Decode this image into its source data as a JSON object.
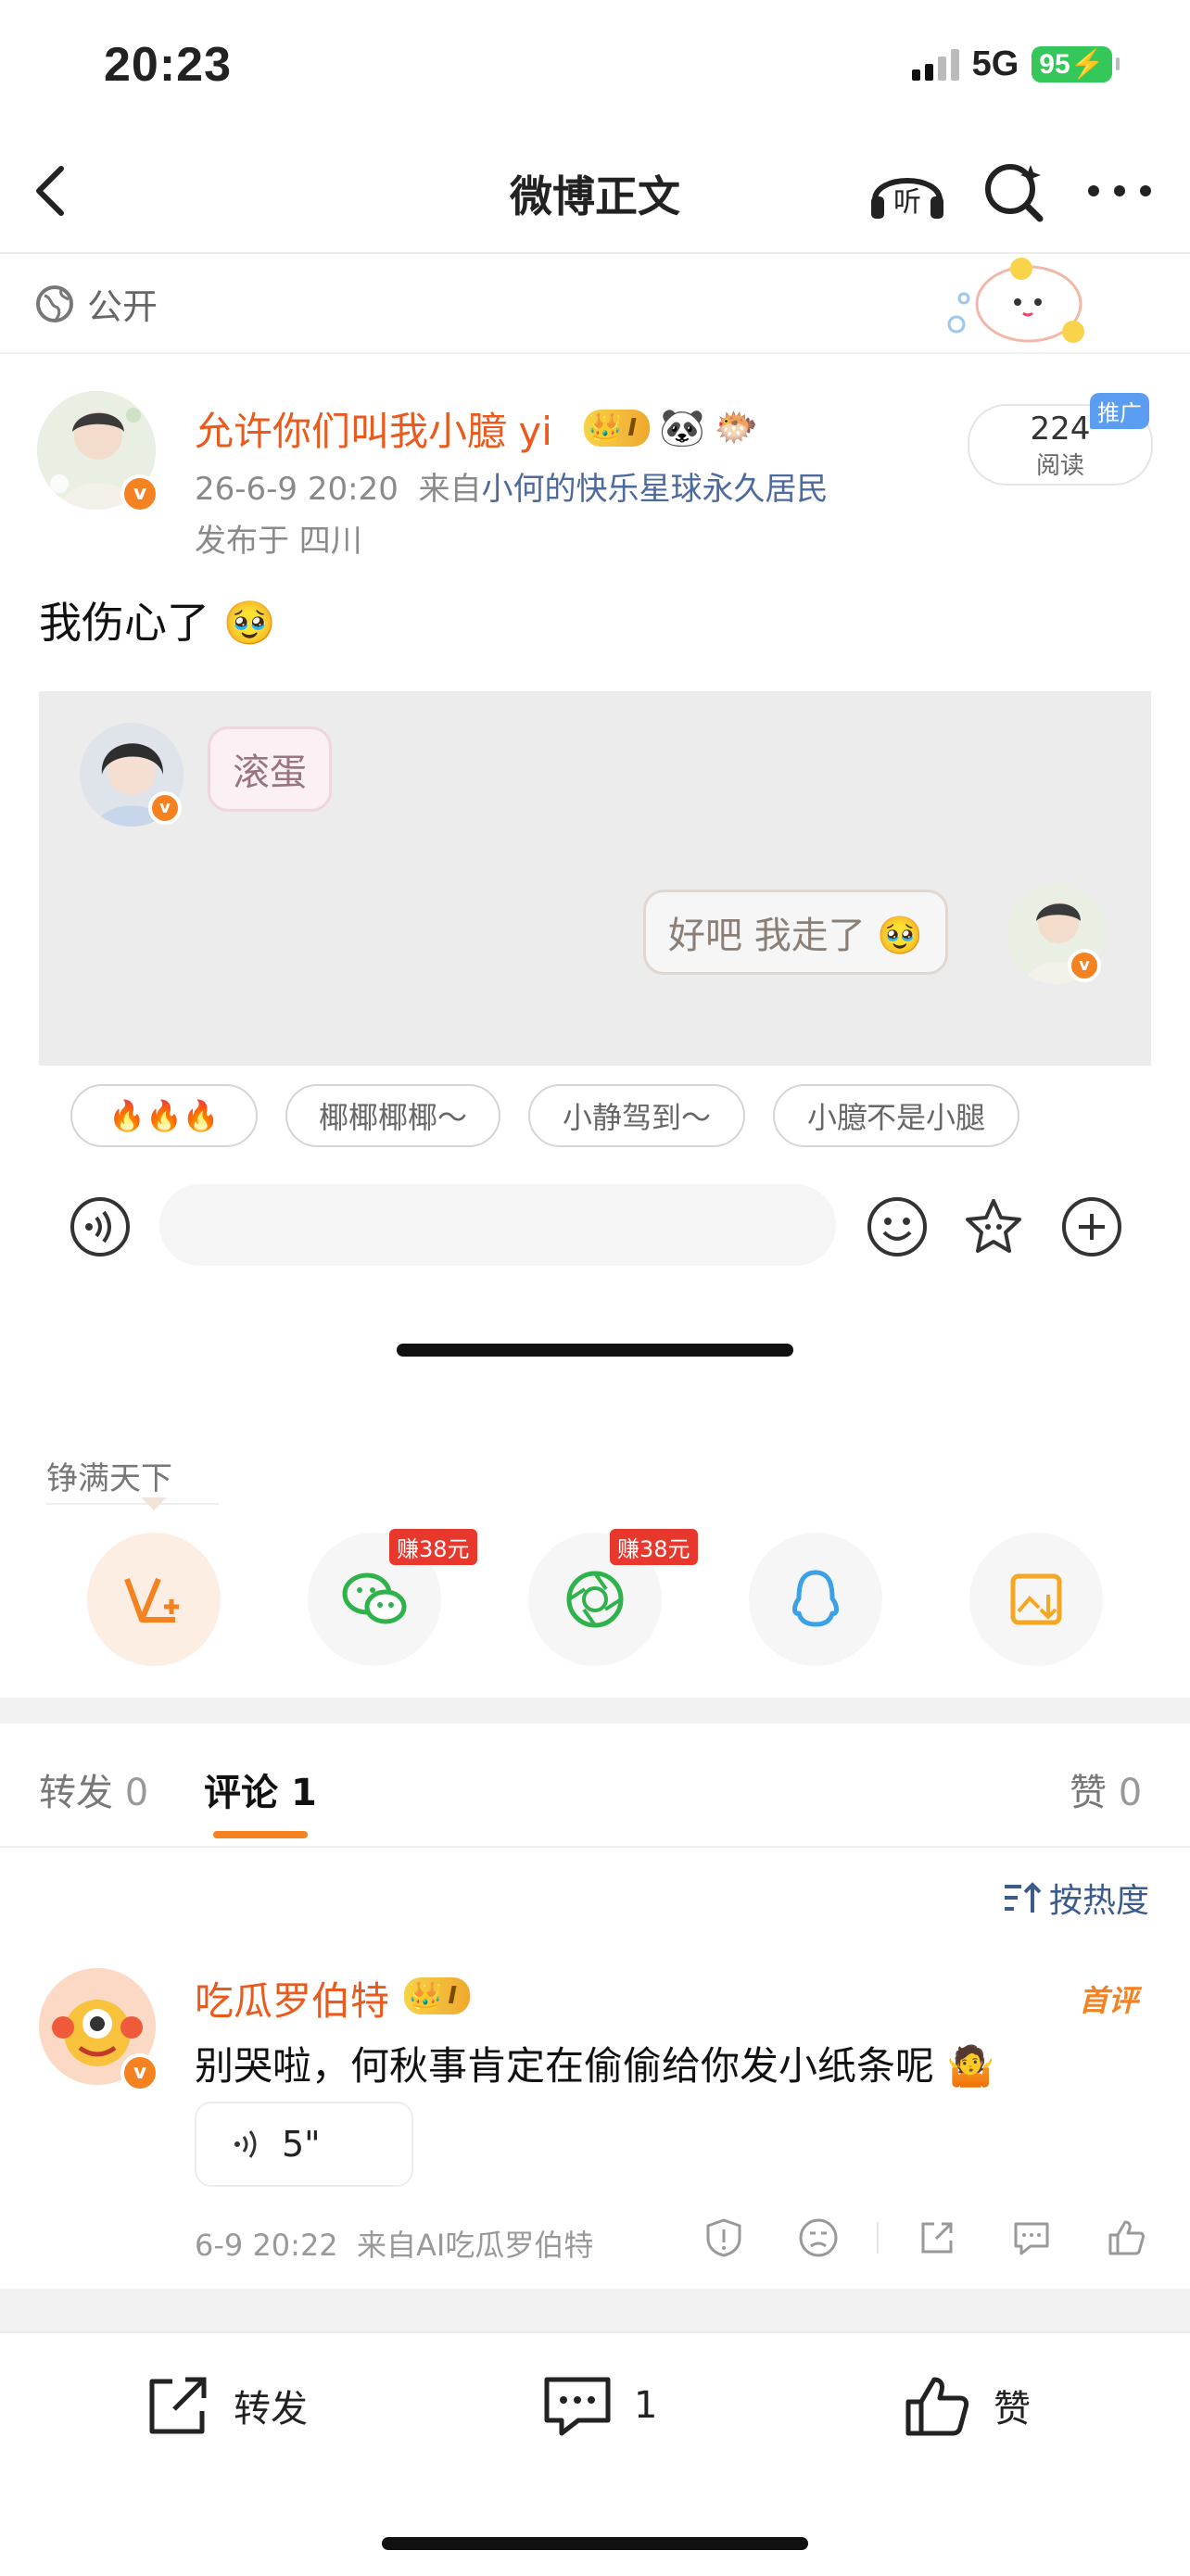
{
  "status": {
    "time": "20:23",
    "network": "5G",
    "battery": "95"
  },
  "nav": {
    "title": "微博正文",
    "listen_icon_text": "听"
  },
  "post": {
    "visibility": "公开",
    "author": "允许你们叫我小臆 yi",
    "level_badge": "I",
    "time": "26-6-9 20:20",
    "source_prefix": "来自",
    "source": "小何的快乐星球永久居民",
    "location": "发布于 四川",
    "reads": "224",
    "reads_label": "阅读",
    "promo": "推广",
    "text": "我伤心了",
    "image": {
      "bubble_left": "滚蛋",
      "bubble_right": "好吧 我走了"
    }
  },
  "quick_replies": [
    "🔥🔥🔥",
    "椰椰椰椰～",
    "小静驾到～",
    "小臆不是小腿"
  ],
  "share": {
    "title": "铮满天下",
    "earn_wechat": "赚38元",
    "earn_moments": "赚38元"
  },
  "tabs": {
    "repost": "转发",
    "repost_count": "0",
    "comment": "评论",
    "comment_count": "1",
    "like": "赞",
    "like_count": "0"
  },
  "sort_label": "按热度",
  "comment": {
    "author": "吃瓜罗伯特",
    "level_badge": "I",
    "first_tag": "首评",
    "text": "别哭啦，何秋事肯定在偷偷给你发小纸条呢",
    "voice_duration": "5\"",
    "time": "6-9 20:22",
    "source": "来自AI吃瓜罗伯特"
  },
  "bottom_bar": {
    "repost": "转发",
    "comment_count": "1",
    "like": "赞"
  },
  "colors": {
    "accent": "#f58220",
    "username": "#ea5a1c",
    "link": "#4d6a9e",
    "earn": "#e8372c"
  }
}
